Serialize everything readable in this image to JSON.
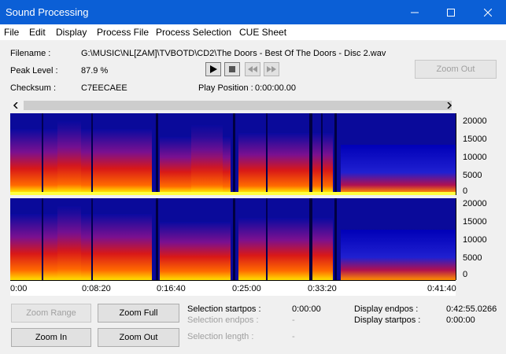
{
  "window": {
    "title": "Sound Processing",
    "colors": {
      "titlebar": "#0b5fd6",
      "disabled_text": "#a0a0a0"
    }
  },
  "menu": [
    "File",
    "Edit",
    "Display",
    "Process File",
    "Process Selection",
    "CUE Sheet"
  ],
  "info": {
    "filename_label": "Filename :",
    "filename_value": "G:\\MUSIC\\NL[ZAM]\\TVBOTD\\CD2\\The Doors - Best Of The Doors - Disc 2.wav",
    "peak_label": "Peak Level :",
    "peak_value": "87.9 %",
    "checksum_label": "Checksum :",
    "checksum_value": "C7EECAEE",
    "play_position_label": "Play Position :",
    "play_position_value": "0:00:00.00"
  },
  "transport": {
    "icons": [
      "play-icon",
      "stop-icon",
      "rewind-icon",
      "fast-forward-icon"
    ]
  },
  "buttons": {
    "zoom_out_top": "Zoom Out",
    "zoom_range": "Zoom Range",
    "zoom_full": "Zoom Full",
    "zoom_in": "Zoom In",
    "zoom_out": "Zoom Out"
  },
  "freq_axis_ticks": [
    "20000",
    "15000",
    "10000",
    "5000",
    "0"
  ],
  "time_axis_ticks": [
    "0:00",
    "0:08:20",
    "0:16:40",
    "0:25:00",
    "0:33:20",
    "0:41:40"
  ],
  "selection": {
    "startpos_label": "Selection startpos :",
    "startpos_value": "0:00:00",
    "endpos_label": "Selection endpos :",
    "endpos_value": "-",
    "length_label": "Selection length :",
    "length_value": "-"
  },
  "display": {
    "endpos_label": "Display endpos :",
    "endpos_value": "0:42:55.0266",
    "startpos_label": "Display startpos :",
    "startpos_value": "0:00:00"
  }
}
